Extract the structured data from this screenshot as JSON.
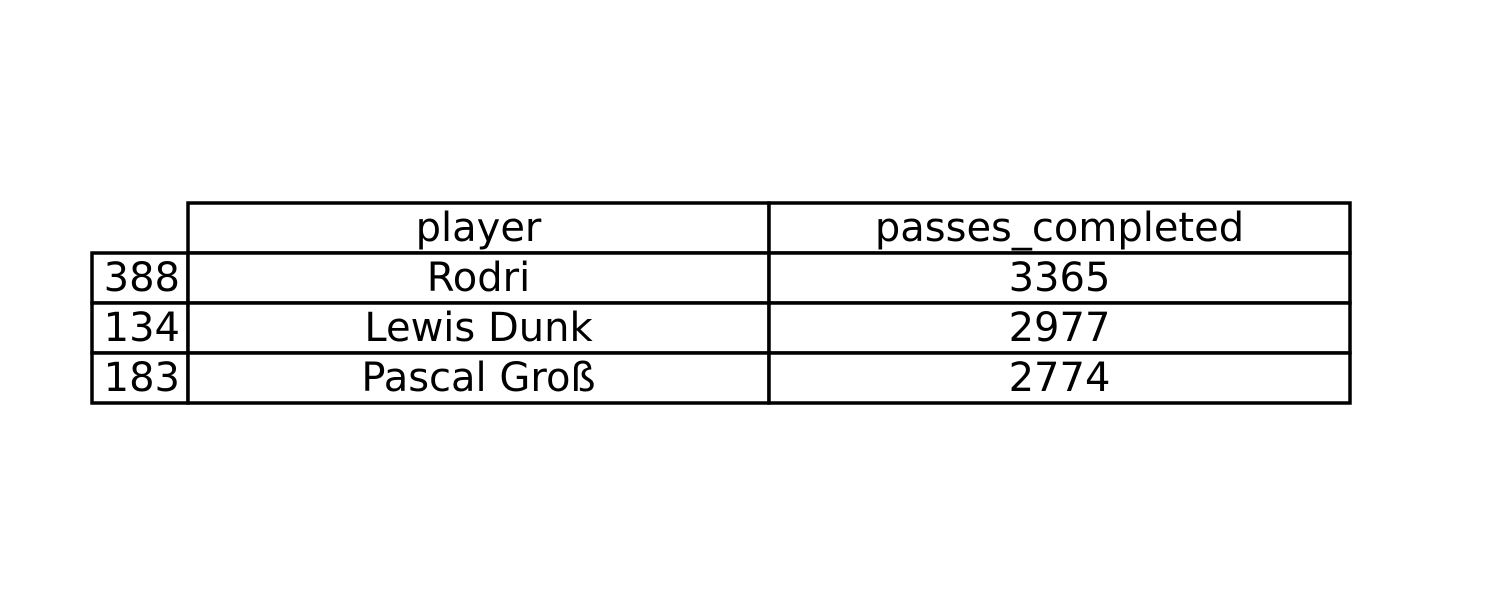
{
  "chart_data": {
    "type": "table",
    "columns": [
      "player",
      "passes_completed"
    ],
    "rows": [
      {
        "index": "388",
        "cells": [
          "Rodri",
          "3365"
        ]
      },
      {
        "index": "134",
        "cells": [
          "Lewis Dunk",
          "2977"
        ]
      },
      {
        "index": "183",
        "cells": [
          "Pascal Groß",
          "2774"
        ]
      }
    ]
  }
}
